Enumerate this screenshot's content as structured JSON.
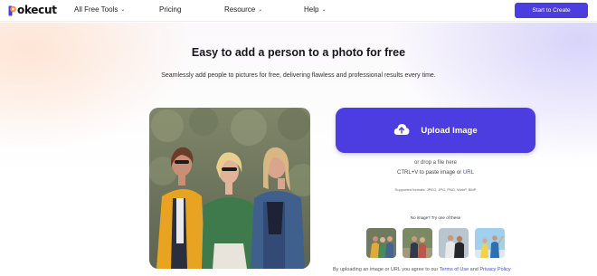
{
  "nav": {
    "logo_text": "okecut",
    "items": [
      {
        "label": "All Free Tools",
        "chevron": true
      },
      {
        "label": "Pricing",
        "chevron": false
      },
      {
        "label": "Resource",
        "chevron": true
      },
      {
        "label": "Help",
        "chevron": true
      }
    ],
    "cta_label": "Start to Create"
  },
  "hero": {
    "title": "Easy to add a person to a photo for free",
    "subtitle": "Seamlessly add people to pictures for free, delivering flawless and professional results every time."
  },
  "upload": {
    "button_label": "Upload Image",
    "icon": "cloud-upload-icon",
    "drop_text": "or drop a file here",
    "paste_text": "CTRL+V to paste image or",
    "url_link": "URL",
    "formats": "Supported formats: JPEG, JPG, PNG, WebP, BMP"
  },
  "samples": {
    "label": "No image? Try one of these"
  },
  "terms": {
    "prefix": "By uploading an image or URL you agree to our",
    "terms_link": "Terms of Use",
    "and": "and",
    "privacy_link": "Privacy Policy"
  },
  "colors": {
    "accent": "#4b3de0",
    "link": "#3a4de0"
  }
}
